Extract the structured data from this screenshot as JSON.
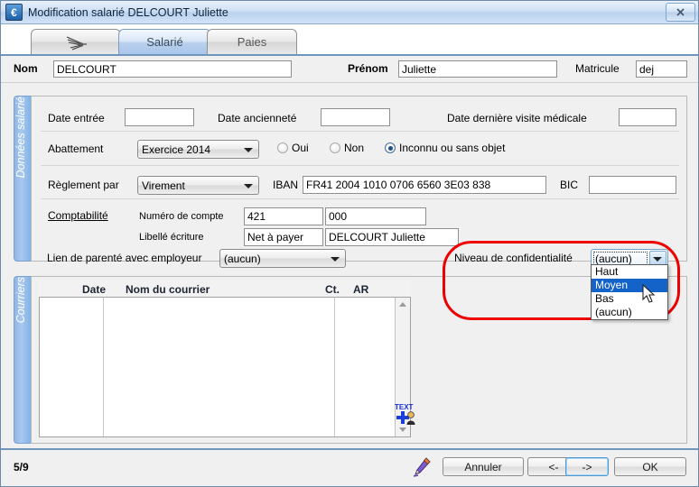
{
  "window": {
    "title": "Modification salarié DELCOURT Juliette",
    "app_icon": "euro-icon",
    "close_label": "✕"
  },
  "tabs": [
    {
      "label": "",
      "icon": "dragonfly-icon",
      "active": false
    },
    {
      "label": "Salarié",
      "active": true
    },
    {
      "label": "Paies",
      "active": false
    }
  ],
  "header": {
    "nom_label": "Nom",
    "nom_value": "DELCOURT",
    "prenom_label": "Prénom",
    "prenom_value": "Juliette",
    "matricule_label": "Matricule",
    "matricule_value": "dej"
  },
  "side_tabs": {
    "donnees": "Données salarié",
    "courriers": "Courriers"
  },
  "form": {
    "date_entree_label": "Date entrée",
    "date_entree_value": "",
    "date_anciennete_label": "Date ancienneté",
    "date_anciennete_value": "",
    "date_visite_label": "Date dernière visite médicale",
    "date_visite_value": "",
    "abattement_label": "Abattement",
    "abattement_value": "Exercice 2014",
    "radios": [
      {
        "label": "Oui",
        "checked": false
      },
      {
        "label": "Non",
        "checked": false
      },
      {
        "label": "Inconnu ou sans objet",
        "checked": true
      }
    ],
    "reglement_label": "Règlement par",
    "reglement_value": "Virement",
    "iban_label": "IBAN",
    "iban_value": "FR41 2004 1010 0706 6560 3E03 838",
    "bic_label": "BIC",
    "bic_value": "",
    "comptabilite_label": "Comptabilité",
    "numero_compte_label": "Numéro de compte",
    "numero_compte_value": "421",
    "numero_compte_value2": "000",
    "libelle_ecriture_label": "Libellé écriture",
    "libelle_ecriture_value": "Net à payer",
    "libelle_ecriture_value2": "DELCOURT Juliette",
    "lien_parente_label": "Lien de parenté avec employeur",
    "lien_parente_value": "(aucun)",
    "confidentialite_label": "Niveau de confidentialité",
    "confidentialite_value": "(aucun)",
    "confidentialite_options": [
      {
        "label": "Haut",
        "selected": false
      },
      {
        "label": "Moyen",
        "selected": true
      },
      {
        "label": "Bas",
        "selected": false
      },
      {
        "label": "(aucun)",
        "selected": false
      }
    ]
  },
  "courriers": {
    "columns": [
      "Date",
      "Nom du courrier",
      "Ct.",
      "AR"
    ],
    "rows": []
  },
  "footer": {
    "page": "5/9",
    "pencil_icon": "pencil-icon",
    "buttons": [
      {
        "label": "Annuler",
        "focused": false
      },
      {
        "label": "<-",
        "focused": false
      },
      {
        "label": "->",
        "focused": true
      },
      {
        "label": "OK",
        "focused": false
      }
    ]
  },
  "annotation": {
    "highlight_color": "#ee0000",
    "selection_color": "#1463c8"
  },
  "icons": {
    "add_text_icon": "add-text-person-icon",
    "mouse_cursor": "mouse-cursor-icon"
  }
}
